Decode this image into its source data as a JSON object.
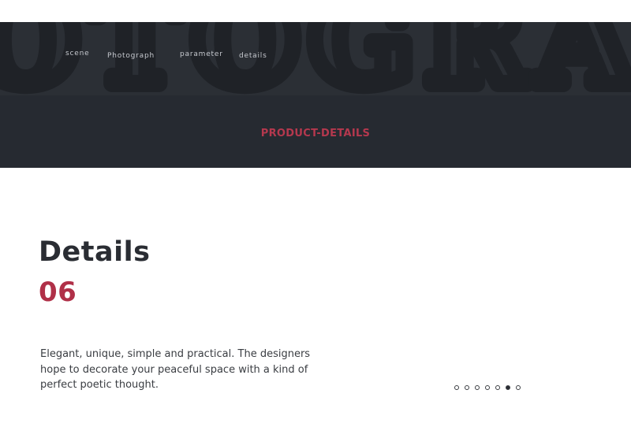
{
  "nav": {
    "items": [
      {
        "label": "scene"
      },
      {
        "label": "Photograph"
      },
      {
        "label": "parameter"
      },
      {
        "label": "details"
      }
    ]
  },
  "hero": {
    "watermark_text": "OTOGRA",
    "title": "PRODUCT-DETAILS"
  },
  "content": {
    "heading": "Details",
    "number": "06",
    "description": "Elegant, unique, simple and practical. The designers hope to decorate your peaceful space with a kind of perfect poetic thought."
  },
  "pager": {
    "total": 7,
    "active_index": 5
  },
  "colors": {
    "hero_bg": "#262a31",
    "hero_top_bg": "#2b2f35",
    "accent": "#b5384e",
    "heading": "#2a2d33",
    "text": "#3a3d42"
  }
}
